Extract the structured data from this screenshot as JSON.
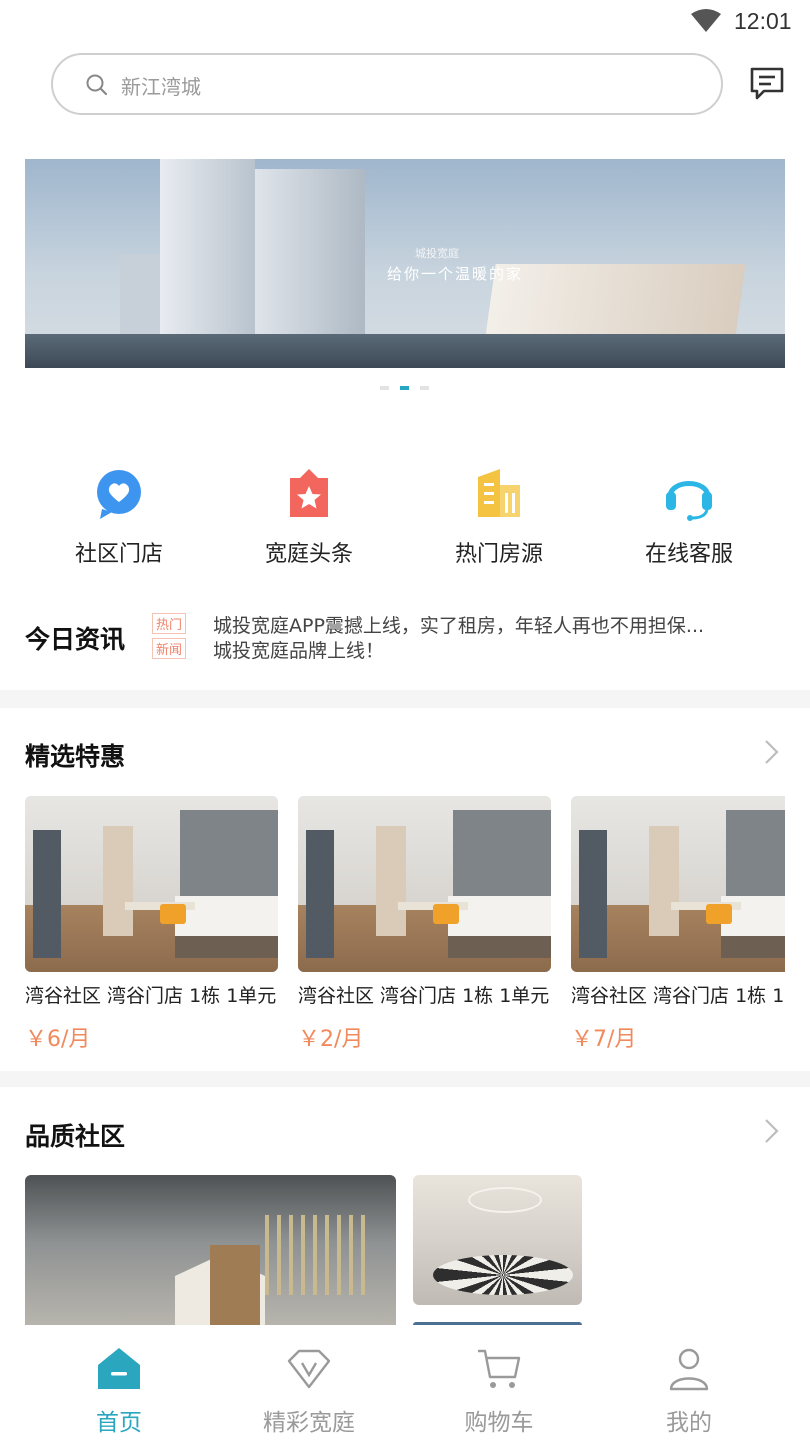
{
  "status_bar": {
    "time": "12:01"
  },
  "search": {
    "placeholder": "新江湾城"
  },
  "banner": {
    "brand": "城投宽庭",
    "slogan": "给你一个温暖的家",
    "page_count": 3,
    "active_page": 2
  },
  "quick_entries": [
    {
      "label": "社区门店",
      "icon": "chat-heart-icon",
      "color": "#3e95f0"
    },
    {
      "label": "宽庭头条",
      "icon": "badge-star-icon",
      "color": "#f2665e"
    },
    {
      "label": "热门房源",
      "icon": "building-icon",
      "color": "#f5c342"
    },
    {
      "label": "在线客服",
      "icon": "headset-icon",
      "color": "#2cb6e6"
    }
  ],
  "news": {
    "title": "今日资讯",
    "items": [
      {
        "tag": "热门",
        "headline": "城投宽庭APP震撼上线，实了租房，年轻人再也不用担保..."
      },
      {
        "tag": "新闻",
        "headline": "城投宽庭品牌上线！"
      }
    ]
  },
  "deals": {
    "title": "精选特惠",
    "items": [
      {
        "name": "湾谷社区 湾谷门店 1栋 1单元",
        "price": "￥6/月"
      },
      {
        "name": "湾谷社区 湾谷门店 1栋 1单元",
        "price": "￥2/月"
      },
      {
        "name": "湾谷社区 湾谷门店 1栋 1",
        "price": "￥7/月"
      }
    ]
  },
  "community": {
    "title": "品质社区"
  },
  "tabbar": {
    "tabs": [
      {
        "label": "首页",
        "icon": "home-icon",
        "active": true
      },
      {
        "label": "精彩宽庭",
        "icon": "diamond-v-icon",
        "active": false
      },
      {
        "label": "购物车",
        "icon": "cart-icon",
        "active": false
      },
      {
        "label": "我的",
        "icon": "user-icon",
        "active": false
      }
    ]
  },
  "colors": {
    "accent": "#2aa6bf",
    "price": "#f08a5d",
    "divider": "#f5f5f5"
  }
}
